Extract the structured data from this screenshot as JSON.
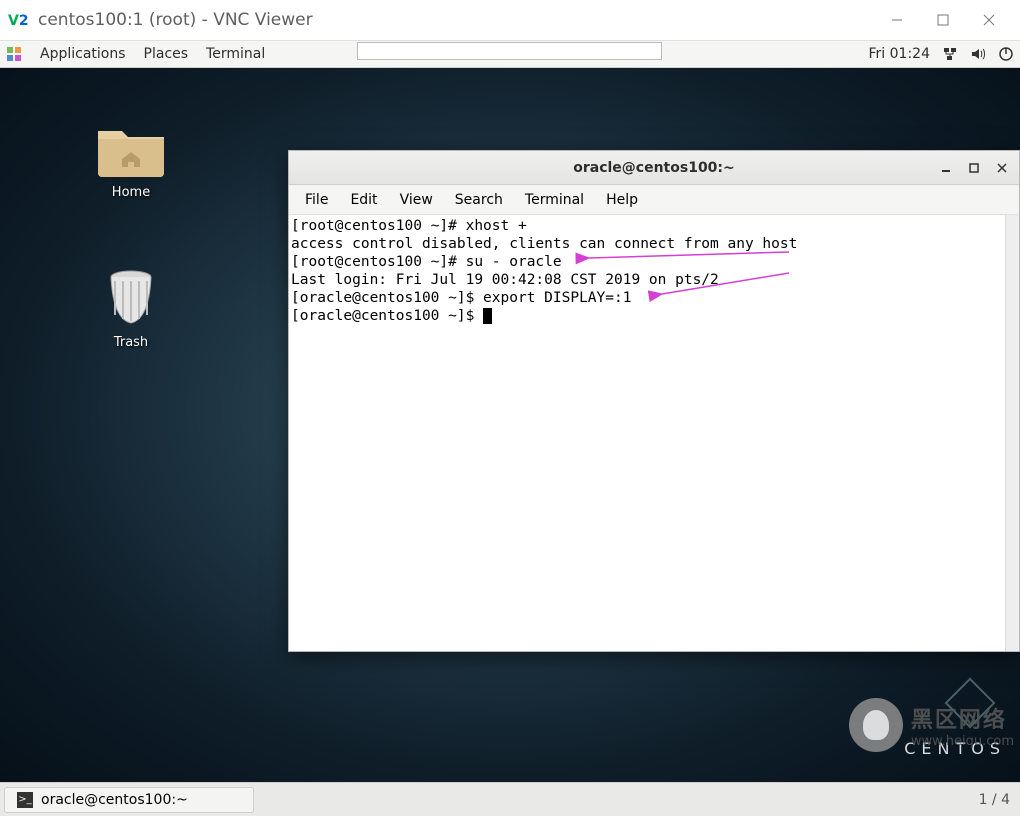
{
  "vnc": {
    "title": "centos100:1 (root) - VNC Viewer"
  },
  "panel": {
    "items": [
      "Applications",
      "Places",
      "Terminal"
    ],
    "clock": "Fri 01:24"
  },
  "desktop": {
    "icons": [
      {
        "label": "Home"
      },
      {
        "label": "Trash"
      }
    ],
    "brand": "CENTOS"
  },
  "terminal": {
    "title": "oracle@centos100:~",
    "menu": [
      "File",
      "Edit",
      "View",
      "Search",
      "Terminal",
      "Help"
    ],
    "lines": [
      "[root@centos100 ~]# xhost +",
      "access control disabled, clients can connect from any host",
      "[root@centos100 ~]# su - oracle",
      "Last login: Fri Jul 19 00:42:08 CST 2019 on pts/2",
      "[oracle@centos100 ~]$ export DISPLAY=:1",
      "[oracle@centos100 ~]$ "
    ]
  },
  "taskbar": {
    "items": [
      {
        "label": "oracle@centos100:~"
      }
    ],
    "pager": "1 / 4"
  },
  "watermark": {
    "line1": "黑区网络",
    "line2": "www.heiqu.com"
  }
}
